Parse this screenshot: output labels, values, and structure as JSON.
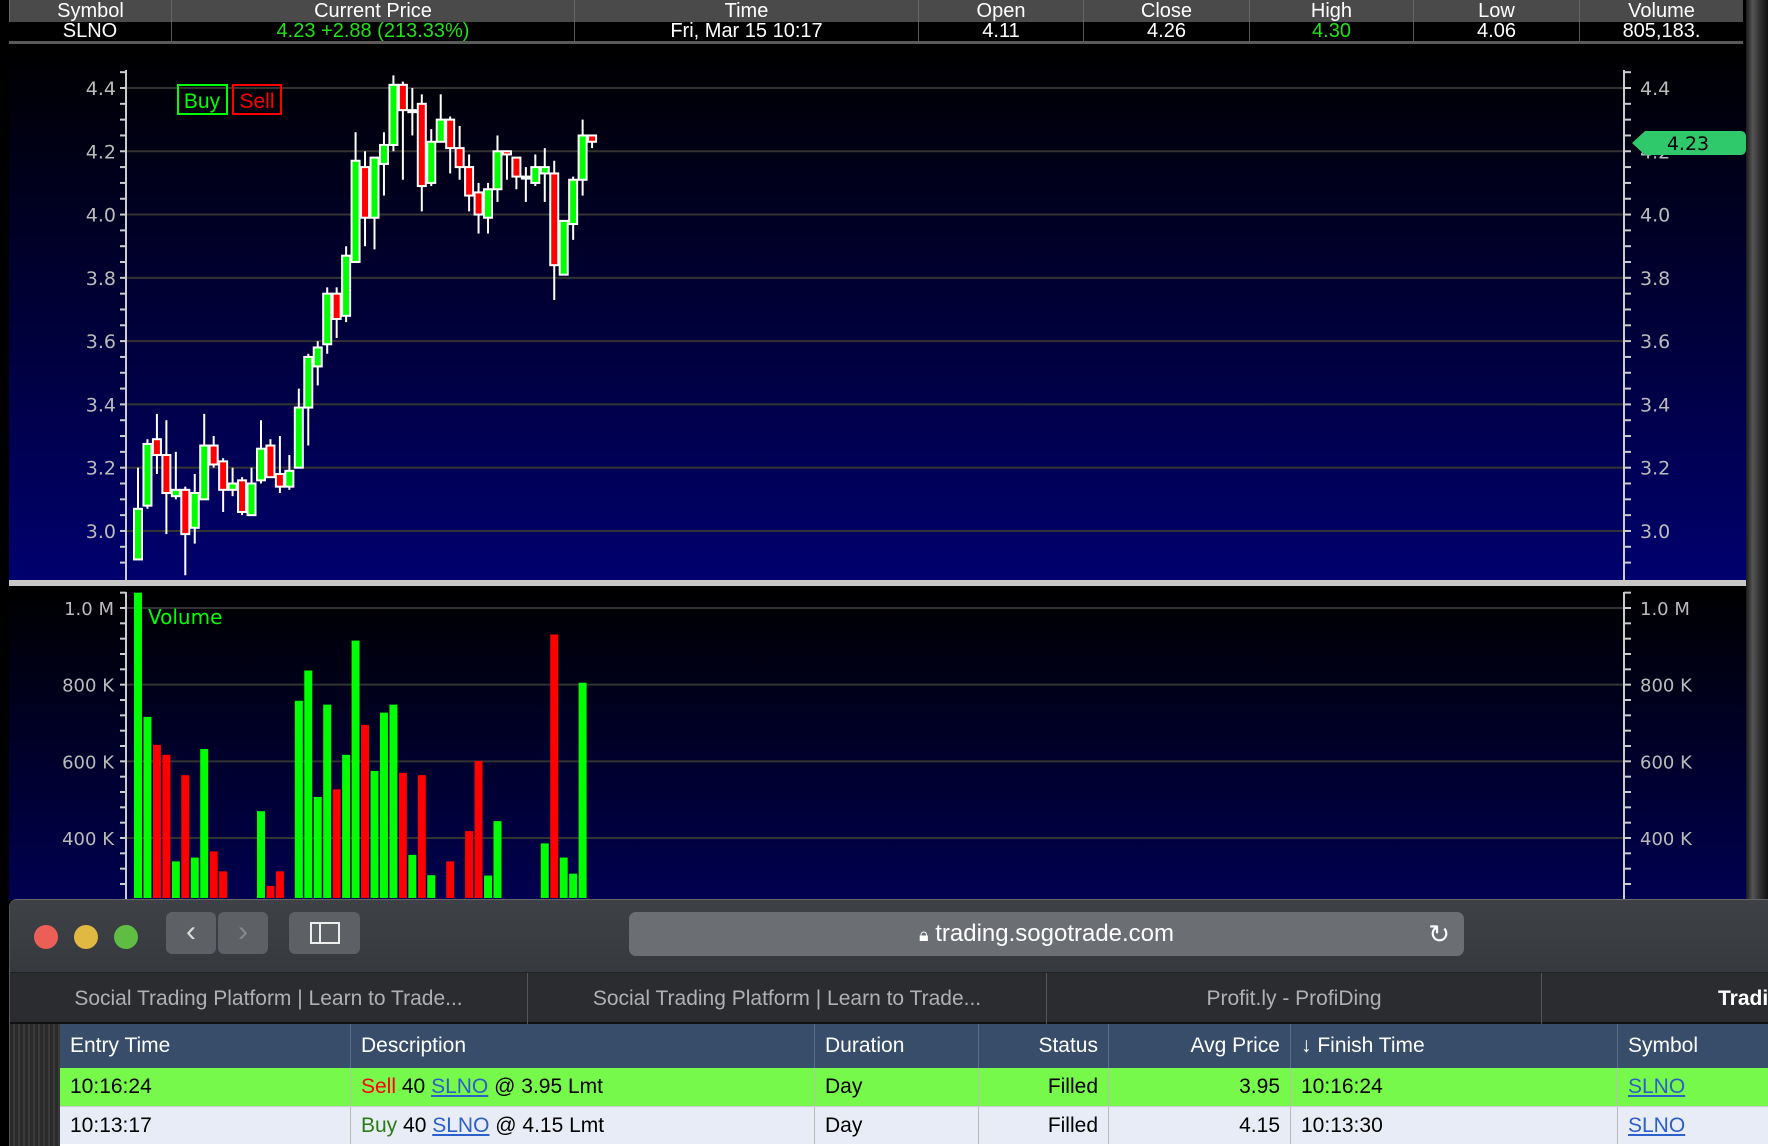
{
  "quote": {
    "headers": [
      "Symbol",
      "Current Price",
      "Time",
      "Open",
      "Close",
      "High",
      "Low",
      "Volume"
    ],
    "symbol": "SLNO",
    "current_price": "4.23  +2.88 (213.33%)",
    "time": "Fri, Mar 15  10:17",
    "open": "4.11",
    "close": "4.26",
    "high": "4.30",
    "low": "4.06",
    "volume": "805,183."
  },
  "chart_data": [
    {
      "type": "candlestick",
      "title": "SLNO price",
      "legend": [
        "Buy",
        "Sell"
      ],
      "legend_placement": "top-left",
      "yticks": [
        "4.4",
        "4.2",
        "4.0",
        "3.8",
        "3.6",
        "3.4",
        "3.2",
        "3.0"
      ],
      "ylim": [
        2.85,
        4.46
      ],
      "last_price_label": "4.23",
      "colors": {
        "up": "#00ff00",
        "down": "#ff0000",
        "grid": "#333333"
      },
      "ohlc": [
        [
          2.91,
          3.2,
          2.91,
          3.07
        ],
        [
          3.08,
          3.29,
          3.07,
          3.275
        ],
        [
          3.29,
          3.37,
          3.18,
          3.24
        ],
        [
          3.24,
          3.35,
          2.99,
          3.12
        ],
        [
          3.11,
          3.25,
          3.1,
          3.13
        ],
        [
          3.13,
          3.14,
          2.86,
          2.99
        ],
        [
          3.01,
          3.18,
          2.96,
          3.12
        ],
        [
          3.1,
          3.37,
          3.1,
          3.27
        ],
        [
          3.27,
          3.3,
          3.2,
          3.21
        ],
        [
          3.22,
          3.23,
          3.06,
          3.13
        ],
        [
          3.13,
          3.2,
          3.11,
          3.15
        ],
        [
          3.16,
          3.17,
          3.05,
          3.06
        ],
        [
          3.05,
          3.2,
          3.05,
          3.15
        ],
        [
          3.16,
          3.35,
          3.15,
          3.26
        ],
        [
          3.27,
          3.29,
          3.17,
          3.17
        ],
        [
          3.18,
          3.3,
          3.12,
          3.14
        ],
        [
          3.14,
          3.24,
          3.13,
          3.19
        ],
        [
          3.2,
          3.45,
          3.2,
          3.39
        ],
        [
          3.39,
          3.56,
          3.27,
          3.55
        ],
        [
          3.52,
          3.6,
          3.46,
          3.58
        ],
        [
          3.59,
          3.77,
          3.56,
          3.75
        ],
        [
          3.75,
          3.77,
          3.61,
          3.67
        ],
        [
          3.68,
          3.9,
          3.66,
          3.87
        ],
        [
          3.85,
          4.26,
          3.85,
          4.17
        ],
        [
          4.15,
          4.2,
          3.9,
          3.99
        ],
        [
          3.99,
          4.18,
          3.89,
          4.18
        ],
        [
          4.16,
          4.26,
          4.06,
          4.22
        ],
        [
          4.22,
          4.44,
          4.2,
          4.41
        ],
        [
          4.41,
          4.42,
          4.11,
          4.33
        ],
        [
          4.33,
          4.4,
          4.25,
          4.33
        ],
        [
          4.35,
          4.38,
          4.01,
          4.09
        ],
        [
          4.1,
          4.27,
          4.09,
          4.23
        ],
        [
          4.23,
          4.38,
          4.23,
          4.3
        ],
        [
          4.3,
          4.31,
          4.13,
          4.21
        ],
        [
          4.21,
          4.28,
          4.11,
          4.15
        ],
        [
          4.15,
          4.19,
          4.01,
          4.06
        ],
        [
          4.07,
          4.1,
          3.94,
          4.0
        ],
        [
          3.99,
          4.1,
          3.94,
          4.08
        ],
        [
          4.08,
          4.25,
          4.04,
          4.2
        ],
        [
          4.2,
          4.2,
          4.11,
          4.19
        ],
        [
          4.18,
          4.18,
          4.08,
          4.12
        ],
        [
          4.12,
          4.15,
          4.04,
          4.12
        ],
        [
          4.1,
          4.19,
          4.09,
          4.15
        ],
        [
          4.13,
          4.21,
          4.04,
          4.15
        ],
        [
          4.13,
          4.17,
          3.73,
          3.84
        ],
        [
          3.81,
          3.98,
          3.81,
          3.98
        ],
        [
          3.97,
          4.12,
          3.92,
          4.11
        ],
        [
          4.11,
          4.3,
          4.06,
          4.25
        ],
        [
          4.25,
          4.25,
          4.21,
          4.23
        ]
      ]
    },
    {
      "type": "bar",
      "title": "Volume",
      "yticks": [
        "1.0 M",
        "800 K",
        "600 K",
        "400 K"
      ],
      "ylim_k": [
        241,
        1000
      ],
      "values_k": [
        [
          1040,
          "up"
        ],
        [
          716,
          "up"
        ],
        [
          643,
          "down"
        ],
        [
          617,
          "down"
        ],
        [
          339,
          "up"
        ],
        [
          564,
          "down"
        ],
        [
          349,
          "up"
        ],
        [
          632,
          "up"
        ],
        [
          365,
          "down"
        ],
        [
          313,
          "down"
        ],
        null,
        null,
        null,
        [
          470,
          "up"
        ],
        [
          275,
          "down"
        ],
        [
          313,
          "down"
        ],
        null,
        [
          758,
          "up"
        ],
        [
          837,
          "up"
        ],
        [
          507,
          "up"
        ],
        [
          748,
          "up"
        ],
        [
          527,
          "down"
        ],
        [
          617,
          "up"
        ],
        [
          915,
          "up"
        ],
        [
          695,
          "down"
        ],
        [
          575,
          "up"
        ],
        [
          727,
          "up"
        ],
        [
          748,
          "up"
        ],
        [
          570,
          "down"
        ],
        [
          356,
          "up"
        ],
        [
          564,
          "down"
        ],
        [
          303,
          "up"
        ],
        null,
        [
          339,
          "down"
        ],
        null,
        [
          418,
          "down"
        ],
        [
          601,
          "down"
        ],
        [
          302,
          "up"
        ],
        [
          444,
          "up"
        ],
        null,
        null,
        null,
        null,
        [
          386,
          "up"
        ],
        [
          931,
          "down"
        ],
        [
          349,
          "up"
        ],
        [
          307,
          "up"
        ],
        [
          805,
          "up"
        ],
        null
      ]
    }
  ],
  "browser": {
    "url": "trading.sogotrade.com",
    "tabs": [
      "Social Trading Platform | Learn to Trade...",
      "Social Trading Platform | Learn to Trade...",
      "Profit.ly - ProfiDing",
      "Trading"
    ]
  },
  "orders": {
    "headers": [
      "Entry Time",
      "Description",
      "Duration",
      "Status",
      "Avg Price",
      "↓ Finish Time",
      "Symbol"
    ],
    "rows": [
      {
        "entry": "10:16:24",
        "side": "Sell",
        "qty": "40",
        "sym": "SLNO",
        "rest": "@ 3.95 Lmt",
        "duration": "Day",
        "status": "Filled",
        "avg": "3.95",
        "finish": "10:16:24",
        "symbol": "SLNO"
      },
      {
        "entry": "10:13:17",
        "side": "Buy",
        "qty": "40",
        "sym": "SLNO",
        "rest": "@ 4.15 Lmt",
        "duration": "Day",
        "status": "Filled",
        "avg": "4.15",
        "finish": "10:13:30",
        "symbol": "SLNO"
      }
    ]
  }
}
